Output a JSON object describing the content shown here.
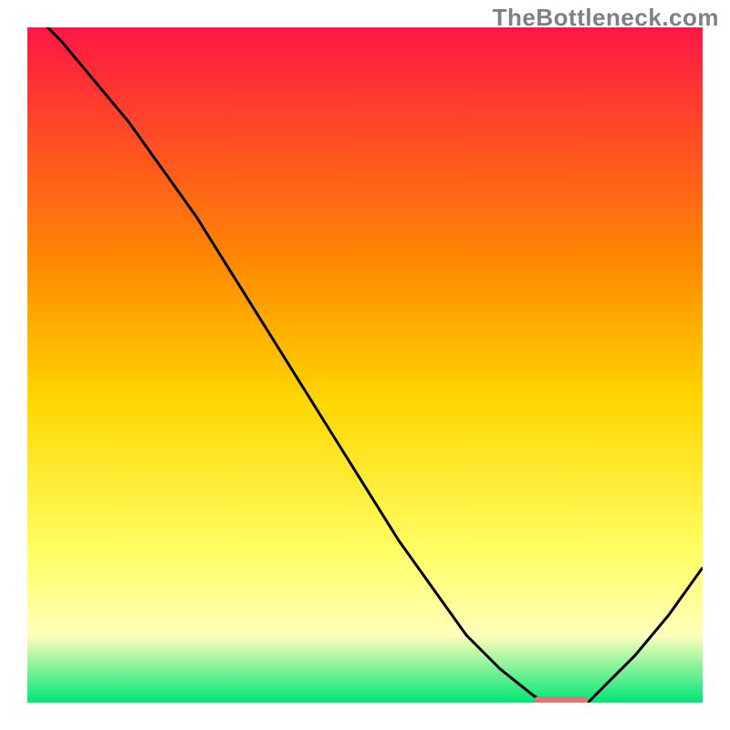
{
  "watermark": "TheBottleneck.com",
  "chart_data": {
    "type": "line",
    "title": "",
    "xlabel": "",
    "ylabel": "",
    "xlim": [
      0,
      100
    ],
    "ylim": [
      0,
      100
    ],
    "grid": false,
    "x": [
      0,
      5,
      10,
      15,
      20,
      25,
      30,
      35,
      40,
      45,
      50,
      55,
      60,
      65,
      70,
      75,
      77,
      80,
      83,
      85,
      90,
      95,
      100
    ],
    "values": [
      103,
      98,
      92,
      86,
      79,
      72,
      64,
      56,
      48,
      40,
      32,
      24,
      17,
      10,
      5,
      1,
      0,
      0,
      0,
      2,
      7,
      13,
      20
    ],
    "marker": {
      "x_start": 75,
      "x_end": 83,
      "y": 0
    }
  },
  "colors": {
    "gradient_top": "#ff1744",
    "gradient_mid1": "#ff8a00",
    "gradient_mid2": "#ffd600",
    "gradient_mid3": "#ffff66",
    "gradient_low": "#ffffbb",
    "gradient_bottom": "#00e676",
    "line": "#000000",
    "marker": "#e57373",
    "axes": "#000000"
  }
}
